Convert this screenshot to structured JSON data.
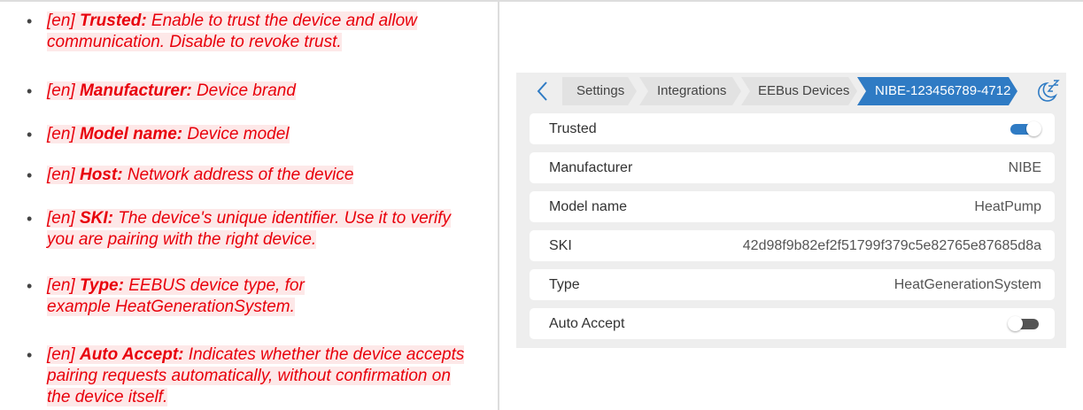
{
  "doc": {
    "bullet": "•",
    "items": [
      {
        "prefix": "[en] ",
        "term": "Trusted:",
        "text": " Enable to trust the device and allow communication. Disable to revoke trust."
      },
      {
        "prefix": "[en] ",
        "term": "Manufacturer:",
        "text": " Device brand"
      },
      {
        "prefix": "[en] ",
        "term": "Model name:",
        "text": " Device model"
      },
      {
        "prefix": "[en] ",
        "term": "Host:",
        "text": " Network address of the device"
      },
      {
        "prefix": "[en] ",
        "term": "SKI:",
        "text": " The device's unique identifier. Use it to verify you are pairing with the right device."
      },
      {
        "prefix": "[en] ",
        "term": "Type:",
        "text": " EEBUS device type, for example HeatGenerationSystem."
      },
      {
        "prefix": "[en] ",
        "term": "Auto Accept:",
        "text": " Indicates whether the device accepts pairing requests automatically, without confirmation on the device itself."
      }
    ]
  },
  "panel": {
    "breadcrumbs": [
      "Settings",
      "Integrations",
      "EEBus Devices",
      "NIBE-123456789-4712"
    ],
    "rows": [
      {
        "label": "Trusted",
        "toggle": true
      },
      {
        "label": "Manufacturer",
        "value": "NIBE"
      },
      {
        "label": "Model name",
        "value": "HeatPump"
      },
      {
        "label": "SKI",
        "value": "42d98f9b82ef2f51799f379c5e82765e87685d8a"
      },
      {
        "label": "Type",
        "value": "HeatGenerationSystem"
      },
      {
        "label": "Auto Accept",
        "toggle": false
      }
    ],
    "icons": {
      "back": "chevron-left-icon",
      "sleep": "sleep-icon"
    }
  },
  "colors": {
    "doc_text": "#e8000b",
    "doc_highlight": "#fde8e8",
    "accent": "#2f7bc4",
    "panel_bg": "#eeeeee",
    "toggle_off": "#555555"
  }
}
